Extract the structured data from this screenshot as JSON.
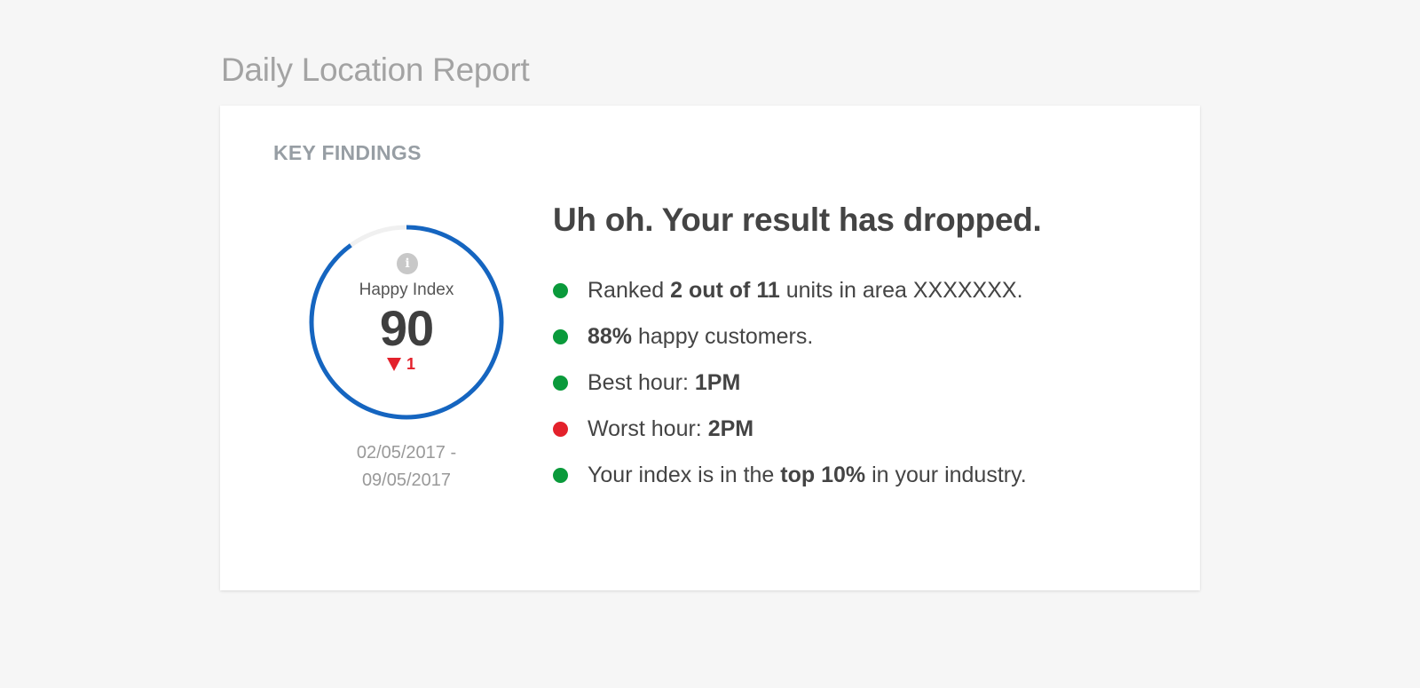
{
  "page": {
    "title": "Daily Location Report"
  },
  "card": {
    "section_label": "KEY FINDINGS",
    "gauge": {
      "info_icon": "info-icon",
      "label": "Happy Index",
      "value": "90",
      "delta": "1",
      "delta_direction": "down",
      "progress_fraction": 0.9,
      "track_color": "#f0f0f0",
      "arc_color": "#1565c0"
    },
    "date_range": {
      "start": "02/05/2017 -",
      "end": "09/05/2017"
    },
    "headline": "Uh oh. Your result has dropped.",
    "findings": [
      {
        "status": "good",
        "pre": "Ranked ",
        "bold": "2 out of 11",
        "post": " units in area XXXXXXX."
      },
      {
        "status": "good",
        "pre": "",
        "bold": "88%",
        "post": " happy customers."
      },
      {
        "status": "good",
        "pre": "Best hour: ",
        "bold": "1PM",
        "post": ""
      },
      {
        "status": "bad",
        "pre": "Worst hour: ",
        "bold": "2PM",
        "post": ""
      },
      {
        "status": "good",
        "pre": "Your index is in the ",
        "bold": "top 10%",
        "post": " in your industry."
      }
    ],
    "status_colors": {
      "good": "#0a9a3b",
      "bad": "#e3212b"
    }
  }
}
